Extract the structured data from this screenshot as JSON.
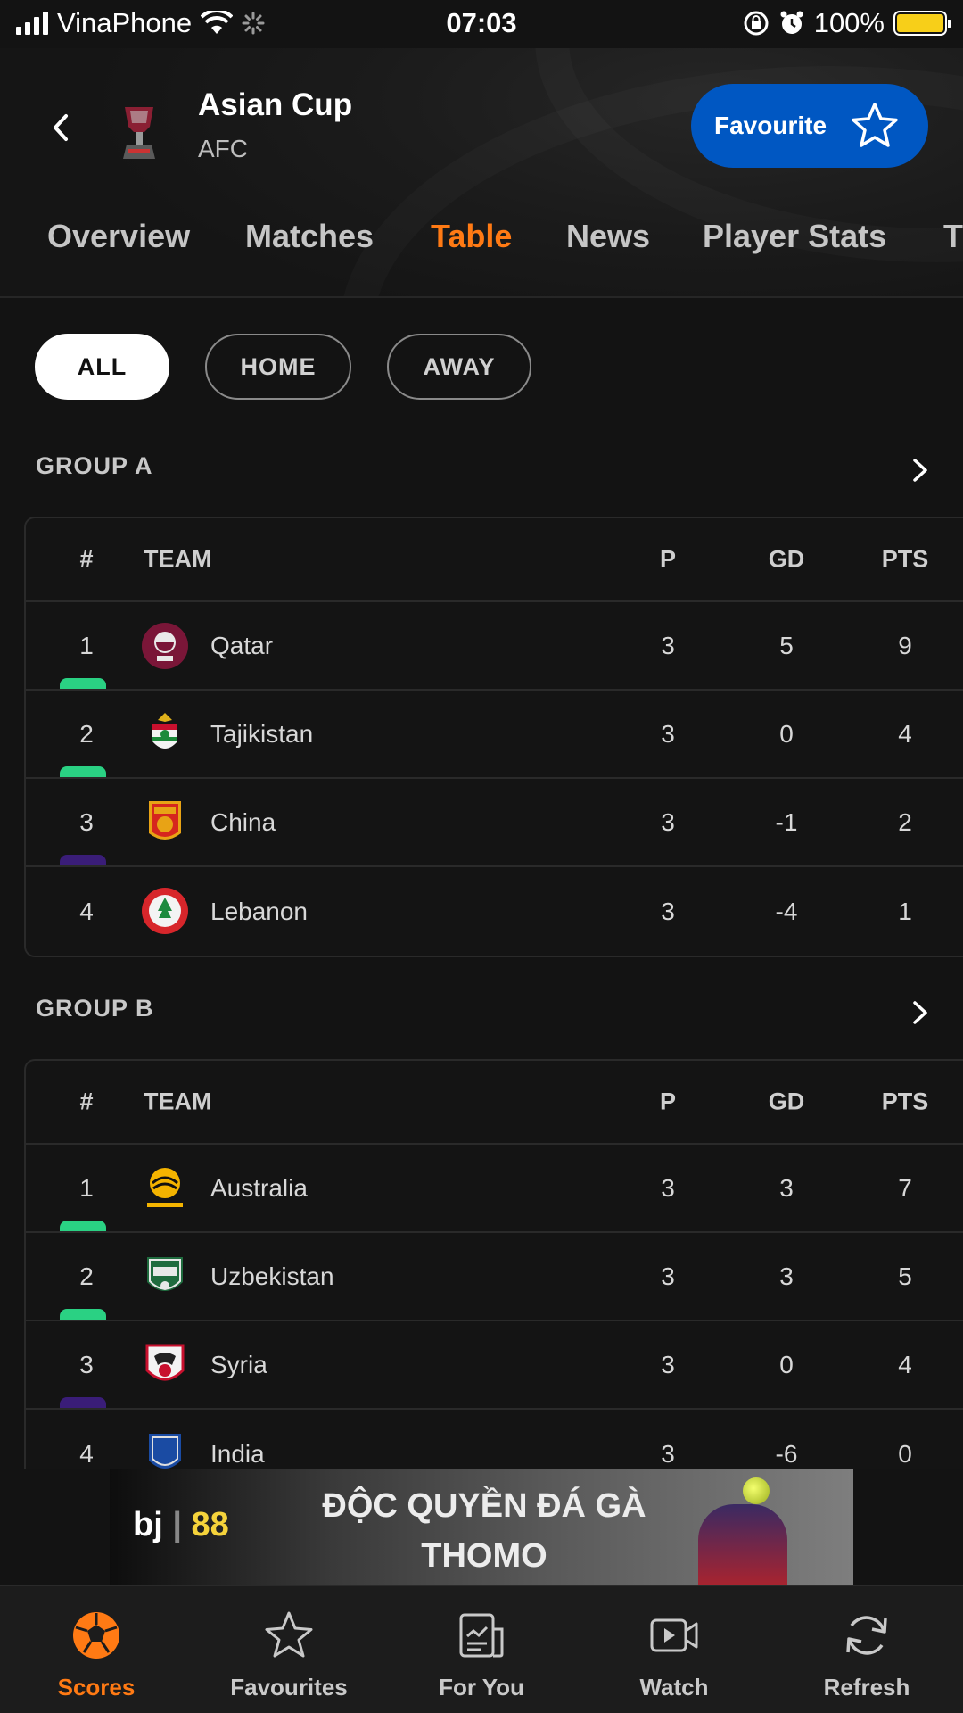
{
  "status_bar": {
    "carrier": "VinaPhone",
    "time": "07:03",
    "battery": "100%"
  },
  "header": {
    "title": "Asian Cup",
    "subtitle": "AFC",
    "favourite_label": "Favourite"
  },
  "tabs": [
    {
      "label": "Overview"
    },
    {
      "label": "Matches"
    },
    {
      "label": "Table",
      "active": true
    },
    {
      "label": "News"
    },
    {
      "label": "Player Stats"
    },
    {
      "label": "T"
    }
  ],
  "filters": [
    {
      "label": "ALL",
      "active": true
    },
    {
      "label": "HOME"
    },
    {
      "label": "AWAY"
    }
  ],
  "table_headers": {
    "pos": "#",
    "team": "TEAM",
    "p": "P",
    "gd": "GD",
    "pts": "PTS"
  },
  "groups": [
    {
      "title": "GROUP A",
      "rows": [
        {
          "pos": "1",
          "team": "Qatar",
          "p": "3",
          "gd": "5",
          "pts": "9",
          "qualification": "advance"
        },
        {
          "pos": "2",
          "team": "Tajikistan",
          "p": "3",
          "gd": "0",
          "pts": "4",
          "qualification": "advance"
        },
        {
          "pos": "3",
          "team": "China",
          "p": "3",
          "gd": "-1",
          "pts": "2",
          "qualification": "third-place"
        },
        {
          "pos": "4",
          "team": "Lebanon",
          "p": "3",
          "gd": "-4",
          "pts": "1",
          "qualification": "none"
        }
      ]
    },
    {
      "title": "GROUP B",
      "rows": [
        {
          "pos": "1",
          "team": "Australia",
          "p": "3",
          "gd": "3",
          "pts": "7",
          "qualification": "advance"
        },
        {
          "pos": "2",
          "team": "Uzbekistan",
          "p": "3",
          "gd": "3",
          "pts": "5",
          "qualification": "advance"
        },
        {
          "pos": "3",
          "team": "Syria",
          "p": "3",
          "gd": "0",
          "pts": "4",
          "qualification": "third-place"
        },
        {
          "pos": "4",
          "team": "India",
          "p": "3",
          "gd": "-6",
          "pts": "0",
          "qualification": "none"
        }
      ]
    }
  ],
  "ad": {
    "logo_left": "bj",
    "logo_right": "88",
    "line1": "ĐỘC QUYỀN ĐÁ GÀ",
    "line2": "THOMO"
  },
  "bottom_nav": [
    {
      "label": "Scores",
      "icon": "soccer-ball-icon",
      "active": true
    },
    {
      "label": "Favourites",
      "icon": "star-icon"
    },
    {
      "label": "For You",
      "icon": "news-icon"
    },
    {
      "label": "Watch",
      "icon": "video-icon"
    },
    {
      "label": "Refresh",
      "icon": "refresh-icon"
    }
  ],
  "colors": {
    "accent": "#ff7a14",
    "favourite_button": "#0057c2",
    "advance": "#2ad183",
    "third_place": "#3a1d78",
    "background": "#131313"
  }
}
